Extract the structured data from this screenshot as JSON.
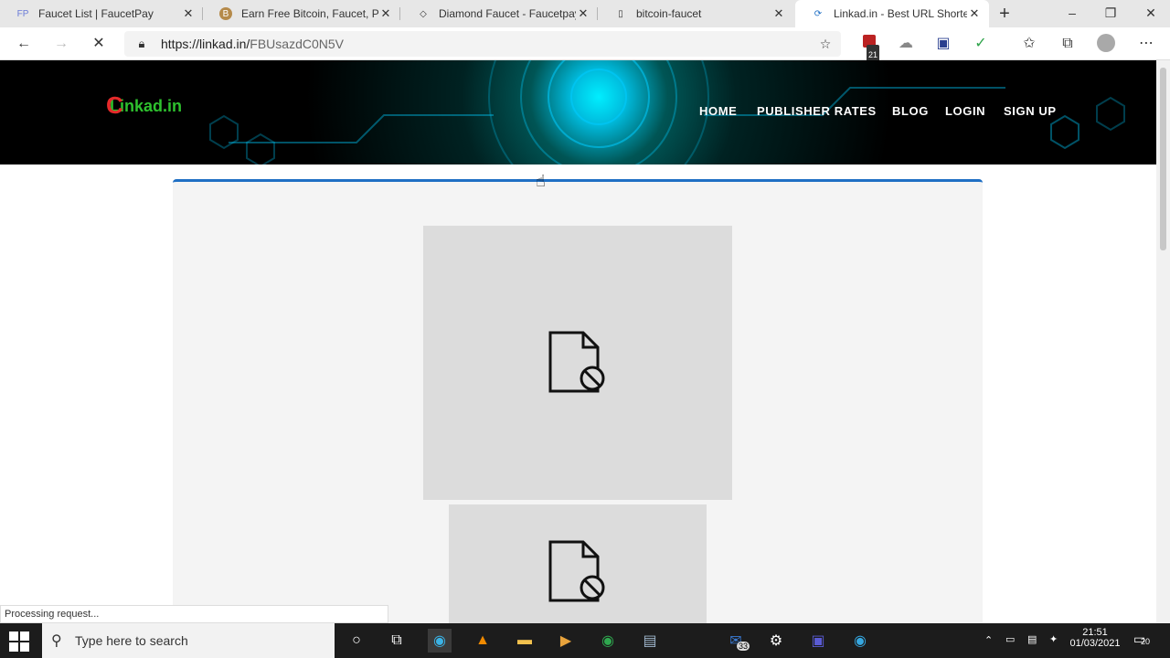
{
  "tabs": [
    {
      "title": "Faucet List | FaucetPay",
      "favicon": "FP"
    },
    {
      "title": "Earn Free Bitcoin, Faucet, PTC A",
      "favicon": "B"
    },
    {
      "title": "Diamond Faucet - Faucetpay Li",
      "favicon": "◇"
    },
    {
      "title": "bitcoin-faucet",
      "favicon": "▯"
    },
    {
      "title": "Linkad.in - Best URL Shortener",
      "favicon": "⟳"
    }
  ],
  "address": {
    "prefix": "https://linkad.in/",
    "path": "FBUsazdC0N5V"
  },
  "extension_badge": "21",
  "site": {
    "logo_mark": "C",
    "logo_text": "Linkad.in",
    "nav": [
      "HOME",
      "PUBLISHER RATES",
      "BLOG",
      "LOGIN",
      "SIGN UP"
    ]
  },
  "status": "Processing request...",
  "taskbar": {
    "search_placeholder": "Type here to search",
    "mail_badge": "33",
    "time": "21:51",
    "date": "01/03/2021",
    "notifications": "20"
  },
  "colors": {
    "accent": "#1f6fc4",
    "logo_green": "#2ec02e",
    "logo_red": "#e42a2a"
  }
}
